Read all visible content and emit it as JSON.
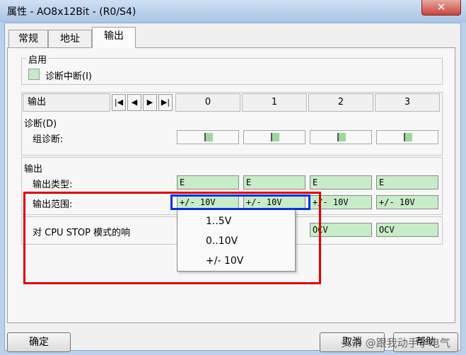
{
  "window": {
    "title": "属性 - AO8x12Bit - (R0/S4)",
    "close_glyph": "✕"
  },
  "tabs": [
    {
      "label": "常规"
    },
    {
      "label": "地址"
    },
    {
      "label": "输出"
    }
  ],
  "enable_group": {
    "legend": "启用",
    "diag_interrupt_label": "诊断中断(I)"
  },
  "header": {
    "output_label": "输出",
    "nav_first": "|◀",
    "nav_prev": "◀",
    "nav_next": "▶",
    "nav_last": "▶|",
    "channels": [
      "0",
      "1",
      "2",
      "3"
    ]
  },
  "diagnostics": {
    "title": "诊断(D)",
    "group_label": "组诊断:"
  },
  "output_section": {
    "title": "输出",
    "type_label": "输出类型:",
    "types": [
      "E",
      "E",
      "E",
      "E"
    ],
    "range_label": "输出范围:",
    "ranges": [
      "+/- 10V",
      "+/- 10V",
      "+/- 10V",
      "+/- 10V"
    ]
  },
  "cpu_stop": {
    "label": "对 CPU STOP 模式的响",
    "values": [
      "OCV",
      "OCV"
    ]
  },
  "dropdown_options": [
    "1..5V",
    "0..10V",
    "+/- 10V"
  ],
  "buttons": {
    "ok": "确定",
    "cancel": "取消",
    "help": "帮助"
  },
  "watermark": "头条 @跟我动手学电气",
  "colors": {
    "field_green": "#c8ecc8",
    "highlight_red": "#e00000",
    "highlight_blue": "#0033dd"
  }
}
